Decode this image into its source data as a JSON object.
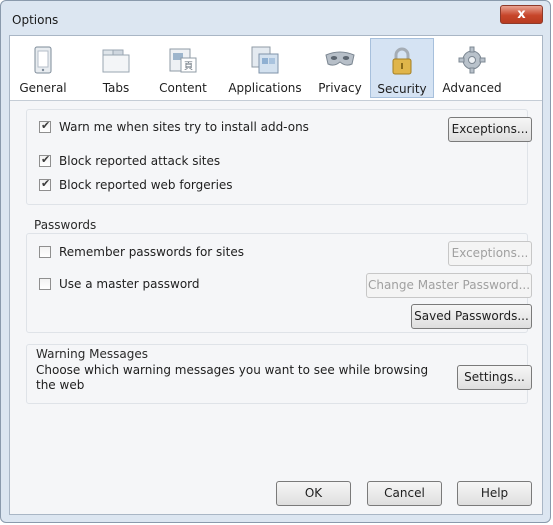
{
  "window": {
    "title": "Options",
    "close_label": "x"
  },
  "tabs": [
    {
      "label": "General",
      "icon": "general-icon"
    },
    {
      "label": "Tabs",
      "icon": "tabs-icon"
    },
    {
      "label": "Content",
      "icon": "content-icon"
    },
    {
      "label": "Applications",
      "icon": "applications-icon"
    },
    {
      "label": "Privacy",
      "icon": "privacy-mask-icon"
    },
    {
      "label": "Security",
      "icon": "padlock-icon",
      "selected": true
    },
    {
      "label": "Advanced",
      "icon": "gear-icon"
    }
  ],
  "security": {
    "warn_addons": {
      "label": "Warn me when sites try to install add-ons",
      "checked": true
    },
    "exceptions_label": "Exceptions...",
    "block_attack": {
      "label": "Block reported attack sites",
      "checked": true
    },
    "block_forgeries": {
      "label": "Block reported web forgeries",
      "checked": true
    }
  },
  "passwords": {
    "heading": "Passwords",
    "remember": {
      "label": "Remember passwords for sites",
      "checked": false
    },
    "exceptions_label": "Exceptions...",
    "master": {
      "label": "Use a master password",
      "checked": false
    },
    "change_master_label": "Change Master Password...",
    "saved_label": "Saved Passwords..."
  },
  "warnings": {
    "heading": "Warning Messages",
    "description": "Choose which warning messages you want to see while browsing the web",
    "settings_label": "Settings..."
  },
  "footer": {
    "ok_label": "OK",
    "cancel_label": "Cancel",
    "help_label": "Help"
  },
  "colors": {
    "selected_tab_bg": "#d5e3f3",
    "close_button": "#c7462a",
    "frame": "#dce6f1"
  }
}
